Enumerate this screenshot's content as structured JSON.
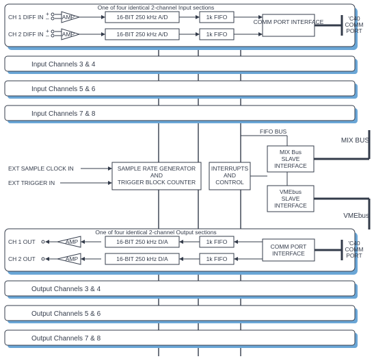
{
  "input": {
    "section_title": "One of four identical 2-channel Input sections",
    "ch1_label": "CH 1 DIFF IN",
    "ch2_label": "CH 2 DIFF IN",
    "amp": "AMP",
    "adc": "16-BIT 250 kHz A/D",
    "fifo": "1k FIFO",
    "comm_port_if": "COMM PORT INTERFACE",
    "comm_port": "'C40 COMM PORT",
    "channels_3_4": "Input Channels 3 & 4",
    "channels_5_6": "Input Channels 5 & 6",
    "channels_7_8": "Input Channels 7 & 8"
  },
  "center": {
    "fifo_bus": "FIFO BUS",
    "mix_bus": "MIX BUS",
    "vme_bus": "VMEbus",
    "mix_slave_if_l1": "MIX Bus",
    "mix_slave_if_l2": "SLAVE",
    "mix_slave_if_l3": "INTERFACE",
    "vme_slave_if_l1": "VMEbus",
    "vme_slave_if_l2": "SLAVE",
    "vme_slave_if_l3": "INTERFACE",
    "ext_sample": "EXT SAMPLE CLOCK IN",
    "ext_trigger": "EXT TRIGGER IN",
    "srg_l1": "SAMPLE RATE GENERATOR",
    "srg_l2": "AND",
    "srg_l3": "TRIGGER BLOCK COUNTER",
    "int_l1": "INTERRUPTS",
    "int_l2": "AND",
    "int_l3": "CONTROL"
  },
  "output": {
    "section_title": "One of four identical 2-channel Output sections",
    "ch1_label": "CH 1 OUT",
    "ch2_label": "CH 2 OUT",
    "amp": "AMP",
    "dac": "16-BIT 250 kHz D/A",
    "fifo": "1k FIFO",
    "comm_port_if": "COMM PORT INTERFACE",
    "comm_port": "'C40 COMM PORT",
    "channels_3_4": "Output Channels 3 & 4",
    "channels_5_6": "Output Channels 5 & 6",
    "channels_7_8": "Output Channels 7 & 8"
  }
}
